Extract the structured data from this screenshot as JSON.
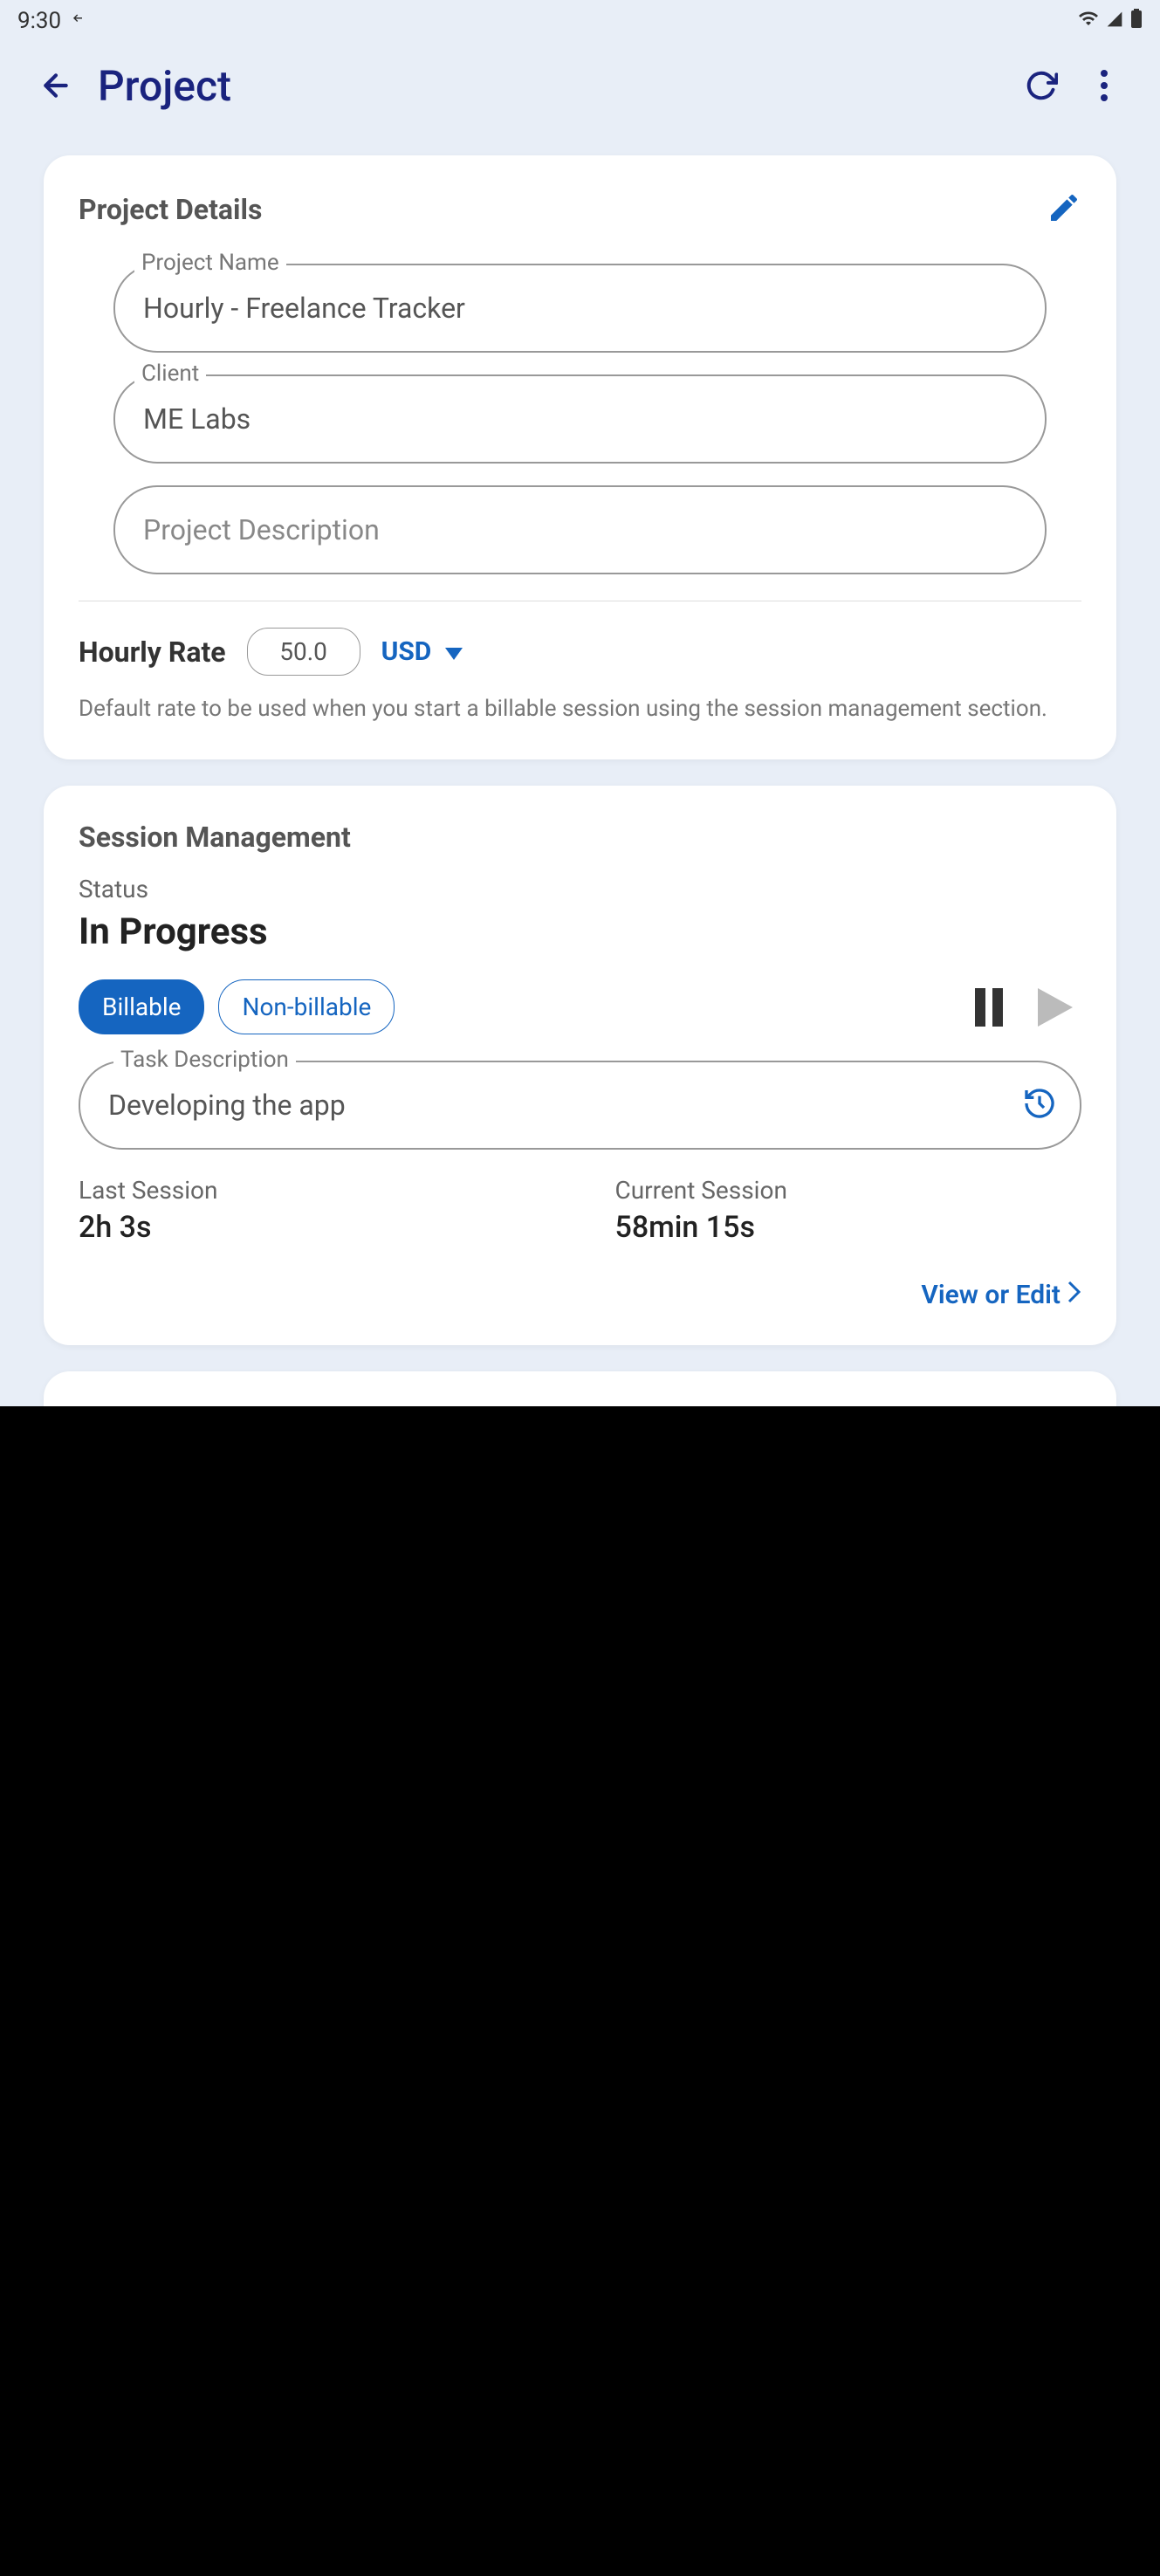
{
  "status_bar": {
    "time": "9:30",
    "nav_icon": "↰"
  },
  "header": {
    "title": "Project"
  },
  "project_details": {
    "title": "Project Details",
    "name_label": "Project Name",
    "name_value": "Hourly - Freelance Tracker",
    "client_label": "Client",
    "client_value": "ME Labs",
    "description_placeholder": "Project Description",
    "rate_label": "Hourly Rate",
    "rate_value": "50.0",
    "currency": "USD",
    "help_text": "Default rate to be used when you start a billable session using the session management section."
  },
  "session_management": {
    "title": "Session Management",
    "status_label": "Status",
    "status_value": "In Progress",
    "billable_label": "Billable",
    "non_billable_label": "Non-billable",
    "task_label": "Task Description",
    "task_value": "Developing the app",
    "last_session_label": "Last Session",
    "last_session_value": "2h 3s",
    "current_session_label": "Current Session",
    "current_session_value": "58min 15s",
    "view_edit_label": "View or Edit"
  }
}
